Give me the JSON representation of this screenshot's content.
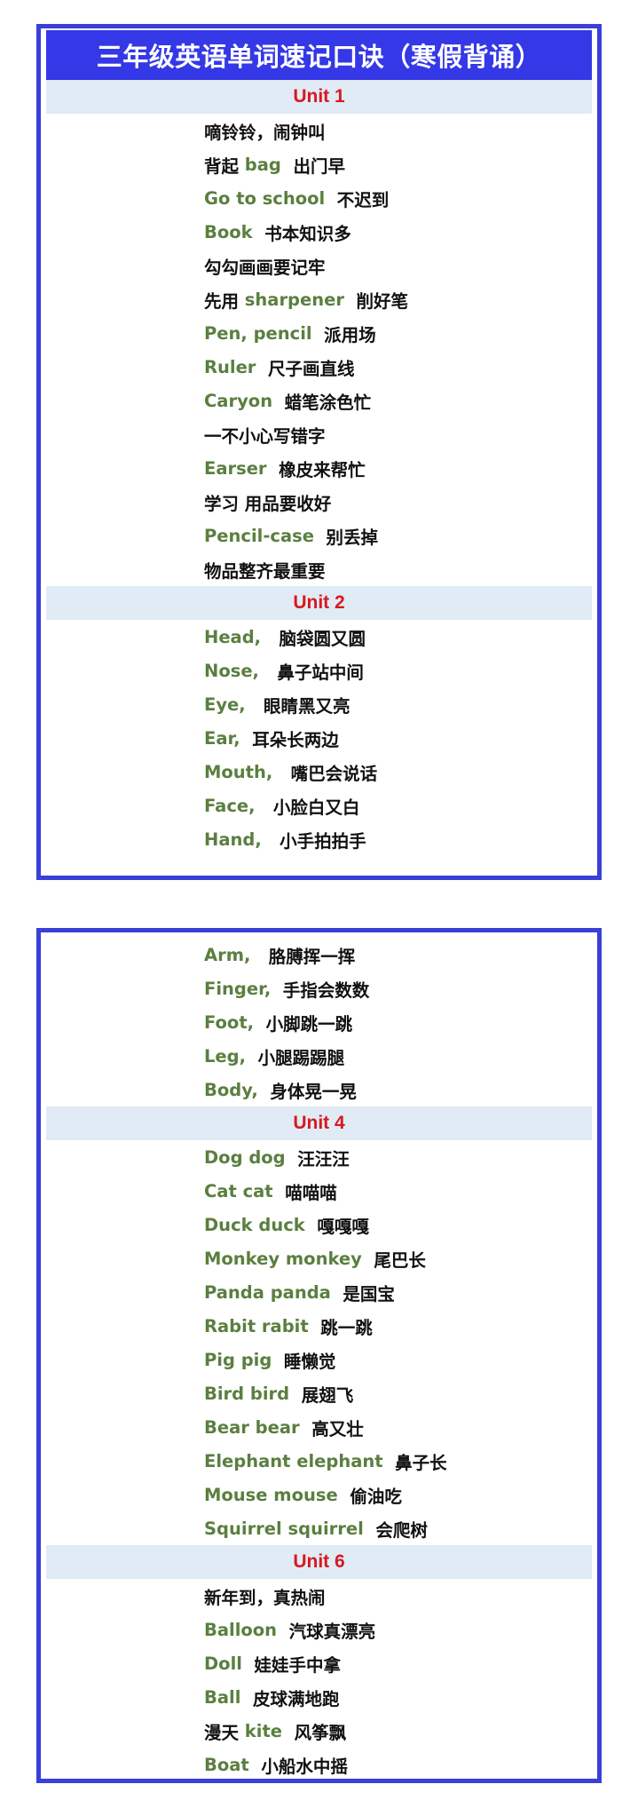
{
  "title": "三年级英语单词速记口诀（寒假背诵）",
  "colors": {
    "frame": "#3a3fd8",
    "title_bg": "#3438e6",
    "unit_bg": "#e0ebf5",
    "unit_text": "#d81820",
    "english": "#5a7f3f",
    "chinese": "#111111"
  },
  "card1": {
    "unit1": {
      "label": "Unit 1",
      "rows": [
        {
          "pre": "嘀铃铃，闹钟叫",
          "en": "",
          "post": ""
        },
        {
          "pre": "背起 ",
          "en": "bag",
          "post": "  出门早"
        },
        {
          "pre": "",
          "en": "Go to school",
          "post": "  不迟到"
        },
        {
          "pre": "",
          "en": "Book",
          "post": "  书本知识多"
        },
        {
          "pre": "勾勾画画要记牢",
          "en": "",
          "post": ""
        },
        {
          "pre": "先用 ",
          "en": "sharpener",
          "post": "  削好笔"
        },
        {
          "pre": "",
          "en": "Pen, pencil",
          "post": "  派用场"
        },
        {
          "pre": "",
          "en": "Ruler",
          "post": "  尺子画直线"
        },
        {
          "pre": "",
          "en": "Caryon",
          "post": "  蜡笔涂色忙"
        },
        {
          "pre": "一不小心写错字",
          "en": "",
          "post": ""
        },
        {
          "pre": "",
          "en": "Earser",
          "post": "  橡皮来帮忙"
        },
        {
          "pre": "学习 用品要收好",
          "en": "",
          "post": ""
        },
        {
          "pre": "",
          "en": "Pencil-case",
          "post": "  别丢掉"
        },
        {
          "pre": "物品整齐最重要",
          "en": "",
          "post": ""
        }
      ]
    },
    "unit2": {
      "label": "Unit 2",
      "rows": [
        {
          "pre": "",
          "en": "Head,",
          "post": "   脑袋圆又圆"
        },
        {
          "pre": "",
          "en": "Nose,",
          "post": "   鼻子站中间"
        },
        {
          "pre": "",
          "en": "Eye,",
          "post": "   眼睛黑又亮"
        },
        {
          "pre": "",
          "en": "Ear,",
          "post": "  耳朵长两边"
        },
        {
          "pre": "",
          "en": "Mouth,",
          "post": "   嘴巴会说话"
        },
        {
          "pre": "",
          "en": "Face,",
          "post": "   小脸白又白"
        },
        {
          "pre": "",
          "en": "Hand,",
          "post": "   小手拍拍手"
        }
      ]
    }
  },
  "card2": {
    "unit3_cont": {
      "rows": [
        {
          "pre": "",
          "en": "Arm,",
          "post": "   胳膊挥一挥"
        },
        {
          "pre": "",
          "en": "Finger,",
          "post": "  手指会数数"
        },
        {
          "pre": "",
          "en": "Foot,",
          "post": "  小脚跳一跳"
        },
        {
          "pre": "",
          "en": "Leg,",
          "post": "  小腿踢踢腿"
        },
        {
          "pre": "",
          "en": "Body,",
          "post": "  身体晃一晃"
        }
      ]
    },
    "unit4": {
      "label": "Unit 4",
      "rows": [
        {
          "pre": "",
          "en": "Dog dog",
          "post": "  汪汪汪"
        },
        {
          "pre": "",
          "en": "Cat cat",
          "post": "  喵喵喵"
        },
        {
          "pre": "",
          "en": "Duck duck",
          "post": "  嘎嘎嘎"
        },
        {
          "pre": "",
          "en": "Monkey monkey",
          "post": "  尾巴长"
        },
        {
          "pre": "",
          "en": "Panda panda",
          "post": "  是国宝"
        },
        {
          "pre": "",
          "en": "Rabit rabit",
          "post": "  跳一跳"
        },
        {
          "pre": "",
          "en": "Pig pig",
          "post": "  睡懒觉"
        },
        {
          "pre": "",
          "en": "Bird bird",
          "post": "  展翅飞"
        },
        {
          "pre": "",
          "en": "Bear bear",
          "post": "  高又壮"
        },
        {
          "pre": "",
          "en": "Elephant elephant",
          "post": "  鼻子长"
        },
        {
          "pre": "",
          "en": "Mouse mouse",
          "post": "  偷油吃"
        },
        {
          "pre": "",
          "en": "Squirrel squirrel",
          "post": "  会爬树"
        }
      ]
    },
    "unit6": {
      "label": "Unit 6",
      "rows": [
        {
          "pre": "新年到，真热闹",
          "en": "",
          "post": ""
        },
        {
          "pre": "",
          "en": "Balloon",
          "post": "  汽球真漂亮"
        },
        {
          "pre": "",
          "en": "Doll",
          "post": "  娃娃手中拿"
        },
        {
          "pre": "",
          "en": "Ball",
          "post": "  皮球满地跑"
        },
        {
          "pre": "漫天 ",
          "en": "kite",
          "post": "  风筝飘"
        },
        {
          "pre": "",
          "en": "Boat",
          "post": "  小船水中摇"
        }
      ]
    }
  }
}
